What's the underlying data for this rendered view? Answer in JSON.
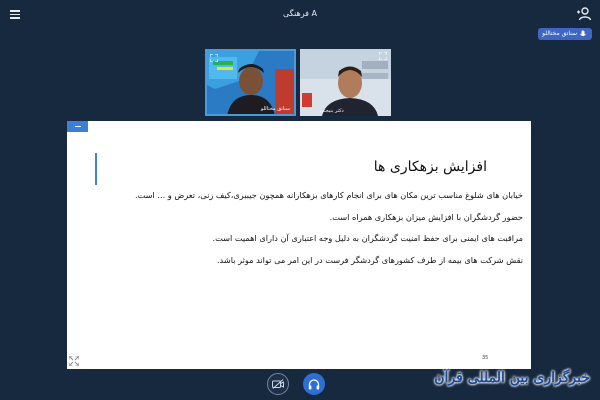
{
  "header": {
    "title": "A فرهنگی",
    "speaker_badge": "سناتق مختاللو"
  },
  "videos": [
    {
      "name": "سناتق مختاللو"
    },
    {
      "name": "دکتر بنیجتی"
    }
  ],
  "slide": {
    "title": "افزایش بزهکاری ها",
    "paragraphs": [
      "خیابان های شلوغ مناسب ترین مکان های برای انجام کارهای بزهکارانه همچون جیببری،کیف زنی، تعرض و ... است.",
      "حضور گردشگران با افزایش میزان بزهکاری همراه است.",
      "مراقبت های ایمنی برای حفظ امنیت گردشگران به دلیل وجه اعتباری آن دارای اهمیت است.",
      "نقش شرکت های بیمه از طرف کشورهای گردشگر فرست در این امر می تواند موثر باشد."
    ],
    "page_number": "35"
  },
  "logo": {
    "text": "خبرگزاری بین المللی قرآن",
    "brand_color": "#1d4b9a"
  },
  "icons": {
    "menu": "menu-icon",
    "users": "users-icon",
    "camera": "camera-icon",
    "headphones": "headphones-icon"
  },
  "colors": {
    "background": "#17293f",
    "accent": "#3c7fd6",
    "mic_button": "#2f6fd5"
  }
}
